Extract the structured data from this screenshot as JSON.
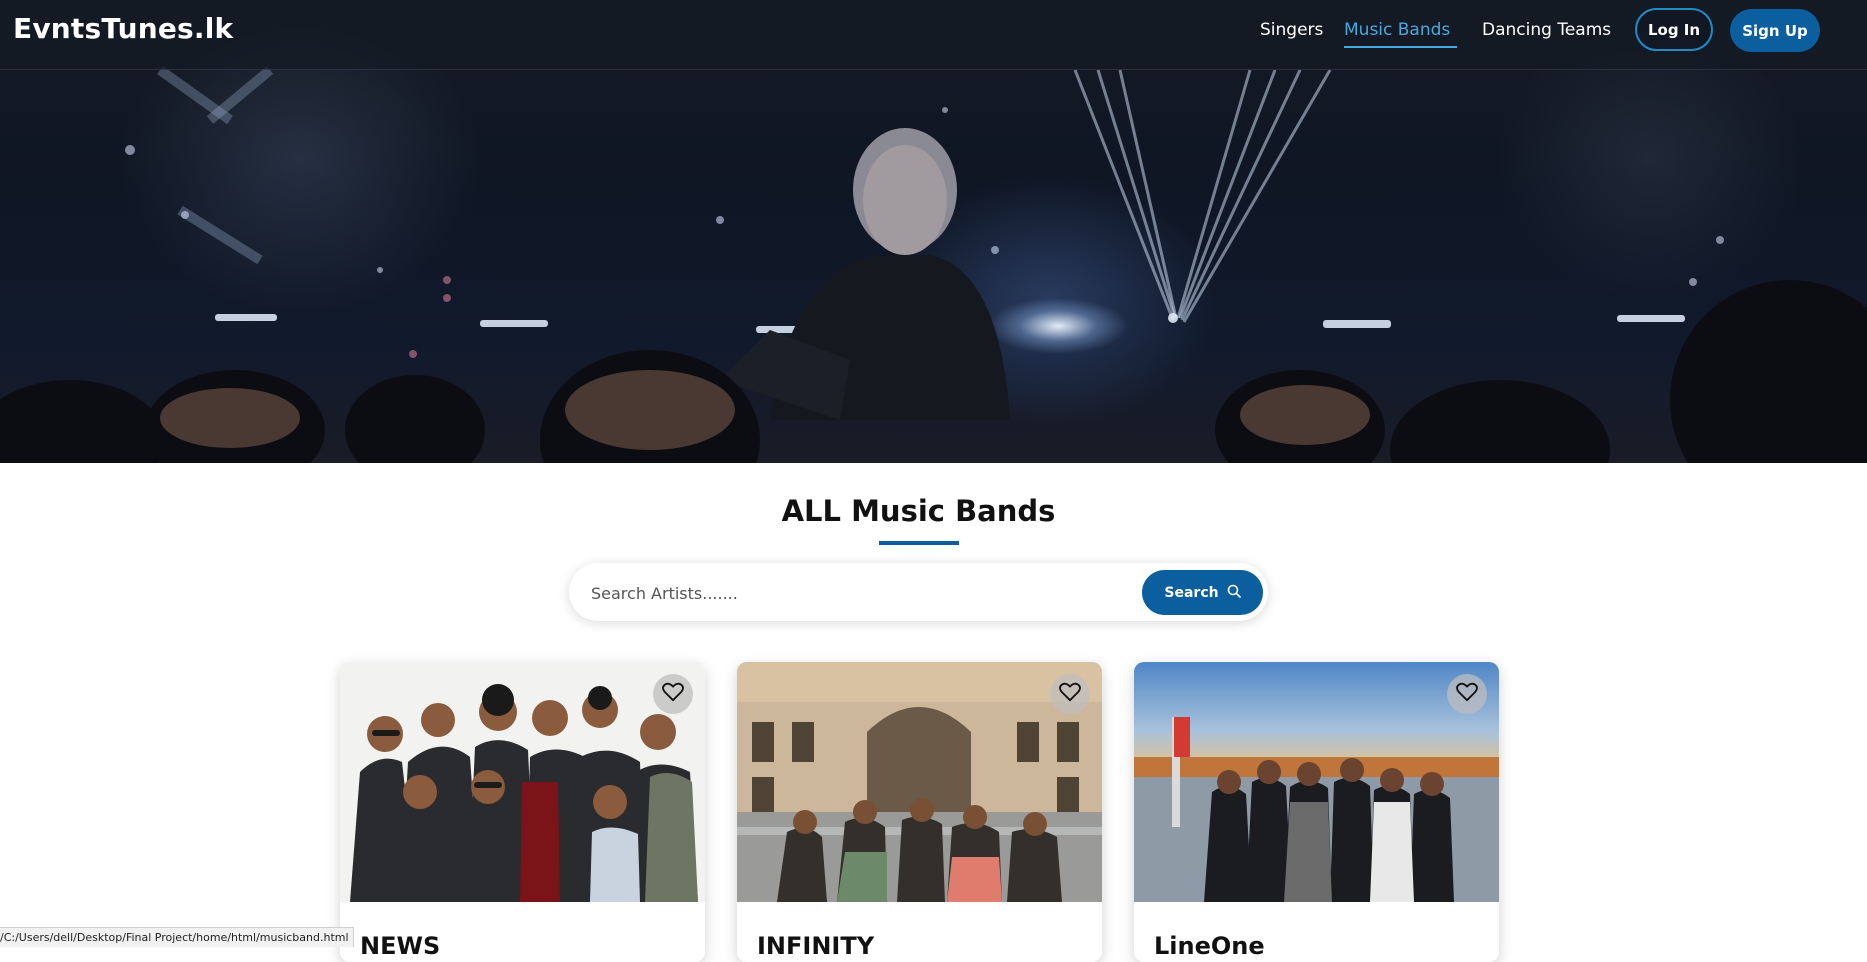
{
  "nav": {
    "logo": "EvntsTunes.lk",
    "links": [
      {
        "label": "Singers",
        "active": false
      },
      {
        "label": "Music Bands",
        "active": true
      },
      {
        "label": "Dancing Teams",
        "active": false
      }
    ],
    "login_label": "Log In",
    "signup_label": "Sign Up"
  },
  "main": {
    "title": "ALL Music Bands",
    "search": {
      "placeholder": "Search Artists.......",
      "value": "",
      "button_label": "Search",
      "button_icon": "search-icon"
    },
    "cards": [
      {
        "name": "NEWS",
        "favorite_icon": "heart-icon"
      },
      {
        "name": "INFINITY",
        "favorite_icon": "heart-icon"
      },
      {
        "name": "LineOne",
        "favorite_icon": "heart-icon"
      }
    ]
  },
  "status_bar": {
    "url": "/C:/Users/dell/Desktop/Final Project/home/html/musicband.html"
  },
  "colors": {
    "accent": "#0c5f9e",
    "active_link": "#4aa8e0",
    "nav_background": "#141a24"
  }
}
